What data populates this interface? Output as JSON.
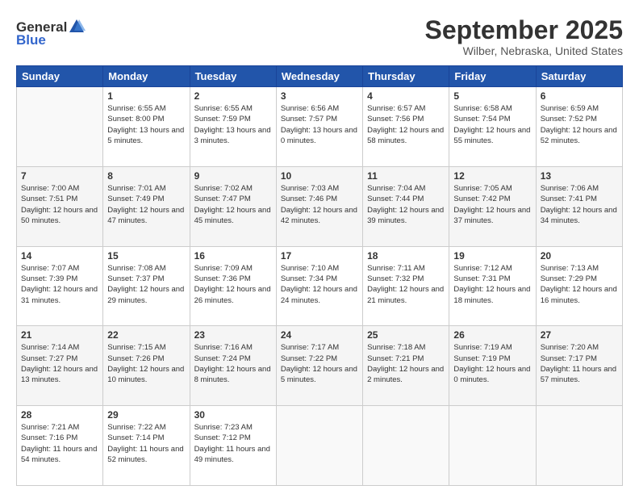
{
  "header": {
    "logo": {
      "general": "General",
      "blue": "Blue"
    },
    "title": "September 2025",
    "location": "Wilber, Nebraska, United States"
  },
  "calendar": {
    "headers": [
      "Sunday",
      "Monday",
      "Tuesday",
      "Wednesday",
      "Thursday",
      "Friday",
      "Saturday"
    ],
    "weeks": [
      [
        {
          "day": "",
          "sunrise": "",
          "sunset": "",
          "daylight": ""
        },
        {
          "day": "1",
          "sunrise": "Sunrise: 6:55 AM",
          "sunset": "Sunset: 8:00 PM",
          "daylight": "Daylight: 13 hours and 5 minutes."
        },
        {
          "day": "2",
          "sunrise": "Sunrise: 6:55 AM",
          "sunset": "Sunset: 7:59 PM",
          "daylight": "Daylight: 13 hours and 3 minutes."
        },
        {
          "day": "3",
          "sunrise": "Sunrise: 6:56 AM",
          "sunset": "Sunset: 7:57 PM",
          "daylight": "Daylight: 13 hours and 0 minutes."
        },
        {
          "day": "4",
          "sunrise": "Sunrise: 6:57 AM",
          "sunset": "Sunset: 7:56 PM",
          "daylight": "Daylight: 12 hours and 58 minutes."
        },
        {
          "day": "5",
          "sunrise": "Sunrise: 6:58 AM",
          "sunset": "Sunset: 7:54 PM",
          "daylight": "Daylight: 12 hours and 55 minutes."
        },
        {
          "day": "6",
          "sunrise": "Sunrise: 6:59 AM",
          "sunset": "Sunset: 7:52 PM",
          "daylight": "Daylight: 12 hours and 52 minutes."
        }
      ],
      [
        {
          "day": "7",
          "sunrise": "Sunrise: 7:00 AM",
          "sunset": "Sunset: 7:51 PM",
          "daylight": "Daylight: 12 hours and 50 minutes."
        },
        {
          "day": "8",
          "sunrise": "Sunrise: 7:01 AM",
          "sunset": "Sunset: 7:49 PM",
          "daylight": "Daylight: 12 hours and 47 minutes."
        },
        {
          "day": "9",
          "sunrise": "Sunrise: 7:02 AM",
          "sunset": "Sunset: 7:47 PM",
          "daylight": "Daylight: 12 hours and 45 minutes."
        },
        {
          "day": "10",
          "sunrise": "Sunrise: 7:03 AM",
          "sunset": "Sunset: 7:46 PM",
          "daylight": "Daylight: 12 hours and 42 minutes."
        },
        {
          "day": "11",
          "sunrise": "Sunrise: 7:04 AM",
          "sunset": "Sunset: 7:44 PM",
          "daylight": "Daylight: 12 hours and 39 minutes."
        },
        {
          "day": "12",
          "sunrise": "Sunrise: 7:05 AM",
          "sunset": "Sunset: 7:42 PM",
          "daylight": "Daylight: 12 hours and 37 minutes."
        },
        {
          "day": "13",
          "sunrise": "Sunrise: 7:06 AM",
          "sunset": "Sunset: 7:41 PM",
          "daylight": "Daylight: 12 hours and 34 minutes."
        }
      ],
      [
        {
          "day": "14",
          "sunrise": "Sunrise: 7:07 AM",
          "sunset": "Sunset: 7:39 PM",
          "daylight": "Daylight: 12 hours and 31 minutes."
        },
        {
          "day": "15",
          "sunrise": "Sunrise: 7:08 AM",
          "sunset": "Sunset: 7:37 PM",
          "daylight": "Daylight: 12 hours and 29 minutes."
        },
        {
          "day": "16",
          "sunrise": "Sunrise: 7:09 AM",
          "sunset": "Sunset: 7:36 PM",
          "daylight": "Daylight: 12 hours and 26 minutes."
        },
        {
          "day": "17",
          "sunrise": "Sunrise: 7:10 AM",
          "sunset": "Sunset: 7:34 PM",
          "daylight": "Daylight: 12 hours and 24 minutes."
        },
        {
          "day": "18",
          "sunrise": "Sunrise: 7:11 AM",
          "sunset": "Sunset: 7:32 PM",
          "daylight": "Daylight: 12 hours and 21 minutes."
        },
        {
          "day": "19",
          "sunrise": "Sunrise: 7:12 AM",
          "sunset": "Sunset: 7:31 PM",
          "daylight": "Daylight: 12 hours and 18 minutes."
        },
        {
          "day": "20",
          "sunrise": "Sunrise: 7:13 AM",
          "sunset": "Sunset: 7:29 PM",
          "daylight": "Daylight: 12 hours and 16 minutes."
        }
      ],
      [
        {
          "day": "21",
          "sunrise": "Sunrise: 7:14 AM",
          "sunset": "Sunset: 7:27 PM",
          "daylight": "Daylight: 12 hours and 13 minutes."
        },
        {
          "day": "22",
          "sunrise": "Sunrise: 7:15 AM",
          "sunset": "Sunset: 7:26 PM",
          "daylight": "Daylight: 12 hours and 10 minutes."
        },
        {
          "day": "23",
          "sunrise": "Sunrise: 7:16 AM",
          "sunset": "Sunset: 7:24 PM",
          "daylight": "Daylight: 12 hours and 8 minutes."
        },
        {
          "day": "24",
          "sunrise": "Sunrise: 7:17 AM",
          "sunset": "Sunset: 7:22 PM",
          "daylight": "Daylight: 12 hours and 5 minutes."
        },
        {
          "day": "25",
          "sunrise": "Sunrise: 7:18 AM",
          "sunset": "Sunset: 7:21 PM",
          "daylight": "Daylight: 12 hours and 2 minutes."
        },
        {
          "day": "26",
          "sunrise": "Sunrise: 7:19 AM",
          "sunset": "Sunset: 7:19 PM",
          "daylight": "Daylight: 12 hours and 0 minutes."
        },
        {
          "day": "27",
          "sunrise": "Sunrise: 7:20 AM",
          "sunset": "Sunset: 7:17 PM",
          "daylight": "Daylight: 11 hours and 57 minutes."
        }
      ],
      [
        {
          "day": "28",
          "sunrise": "Sunrise: 7:21 AM",
          "sunset": "Sunset: 7:16 PM",
          "daylight": "Daylight: 11 hours and 54 minutes."
        },
        {
          "day": "29",
          "sunrise": "Sunrise: 7:22 AM",
          "sunset": "Sunset: 7:14 PM",
          "daylight": "Daylight: 11 hours and 52 minutes."
        },
        {
          "day": "30",
          "sunrise": "Sunrise: 7:23 AM",
          "sunset": "Sunset: 7:12 PM",
          "daylight": "Daylight: 11 hours and 49 minutes."
        },
        {
          "day": "",
          "sunrise": "",
          "sunset": "",
          "daylight": ""
        },
        {
          "day": "",
          "sunrise": "",
          "sunset": "",
          "daylight": ""
        },
        {
          "day": "",
          "sunrise": "",
          "sunset": "",
          "daylight": ""
        },
        {
          "day": "",
          "sunrise": "",
          "sunset": "",
          "daylight": ""
        }
      ]
    ]
  }
}
